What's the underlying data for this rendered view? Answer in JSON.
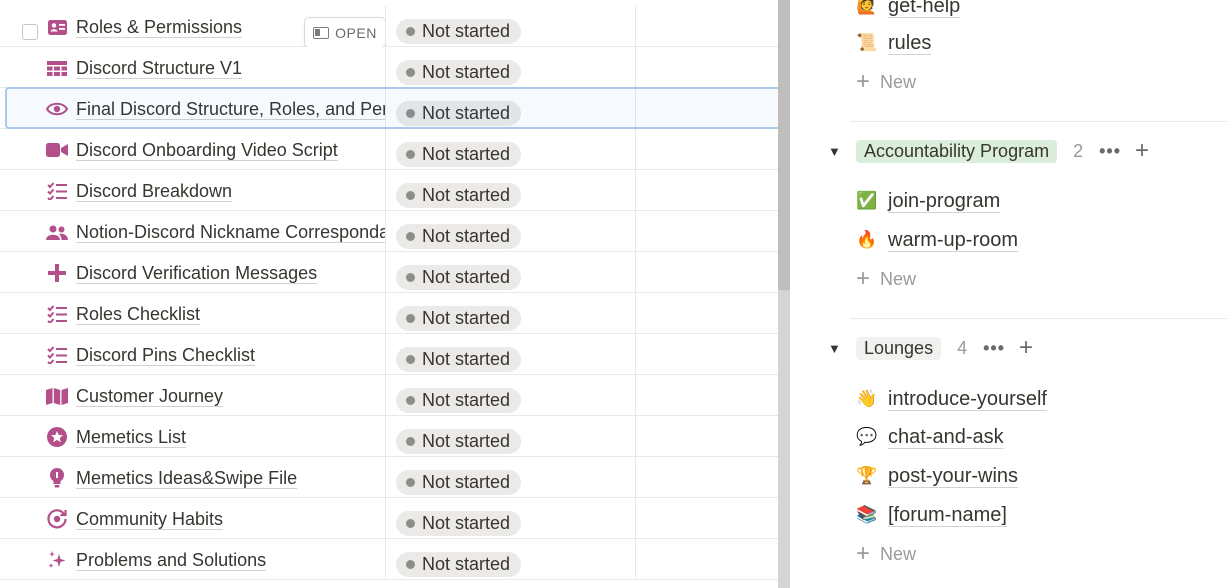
{
  "table": {
    "open_label": "OPEN",
    "rows": [
      {
        "title": "Roles & Permissions",
        "icon": "id-card-icon",
        "status": "Not started"
      },
      {
        "title": "Discord Structure V1",
        "icon": "table-grid-icon",
        "status": "Not started"
      },
      {
        "title": "Final Discord Structure, Roles, and Permissions",
        "icon": "eye-icon",
        "status": "Not started"
      },
      {
        "title": "Discord Onboarding Video Script",
        "icon": "video-camera-icon",
        "status": "Not started"
      },
      {
        "title": "Discord Breakdown",
        "icon": "checklist-icon",
        "status": "Not started"
      },
      {
        "title": "Notion-Discord Nickname Correspondance",
        "icon": "people-icon",
        "status": "Not started"
      },
      {
        "title": "Discord Verification Messages",
        "icon": "plus-cross-icon",
        "status": "Not started"
      },
      {
        "title": "Roles Checklist",
        "icon": "checklist-icon",
        "status": "Not started"
      },
      {
        "title": "Discord Pins Checklist",
        "icon": "checklist-icon",
        "status": "Not started"
      },
      {
        "title": "Customer Journey",
        "icon": "map-icon",
        "status": "Not started"
      },
      {
        "title": "Memetics List",
        "icon": "star-circle-icon",
        "status": "Not started"
      },
      {
        "title": "Memetics Ideas&Swipe File",
        "icon": "lightbulb-icon",
        "status": "Not started"
      },
      {
        "title": "Community Habits",
        "icon": "target-refresh-icon",
        "status": "Not started"
      },
      {
        "title": "Problems and Solutions",
        "icon": "sparkles-icon",
        "status": "Not started"
      }
    ],
    "accent_color": "#b34f8a",
    "status_dot_color": "#8e8d89"
  },
  "board": {
    "top_items": [
      {
        "label": "get-help",
        "emoji": "🙋"
      },
      {
        "label": "rules",
        "emoji": "📜"
      }
    ],
    "new_label": "New",
    "groups": [
      {
        "name": "Accountability Program",
        "count": "2",
        "color": "#dbeddb",
        "items": [
          {
            "label": "join-program",
            "emoji": "✅"
          },
          {
            "label": "warm-up-room",
            "emoji": "🔥"
          }
        ]
      },
      {
        "name": "Lounges",
        "count": "4",
        "color": "#f1f1ef",
        "items": [
          {
            "label": "introduce-yourself",
            "emoji": "👋"
          },
          {
            "label": "chat-and-ask",
            "emoji": "💬"
          },
          {
            "label": "post-your-wins",
            "emoji": "🏆"
          },
          {
            "label": "[forum-name]",
            "emoji": "📚"
          }
        ]
      }
    ]
  }
}
